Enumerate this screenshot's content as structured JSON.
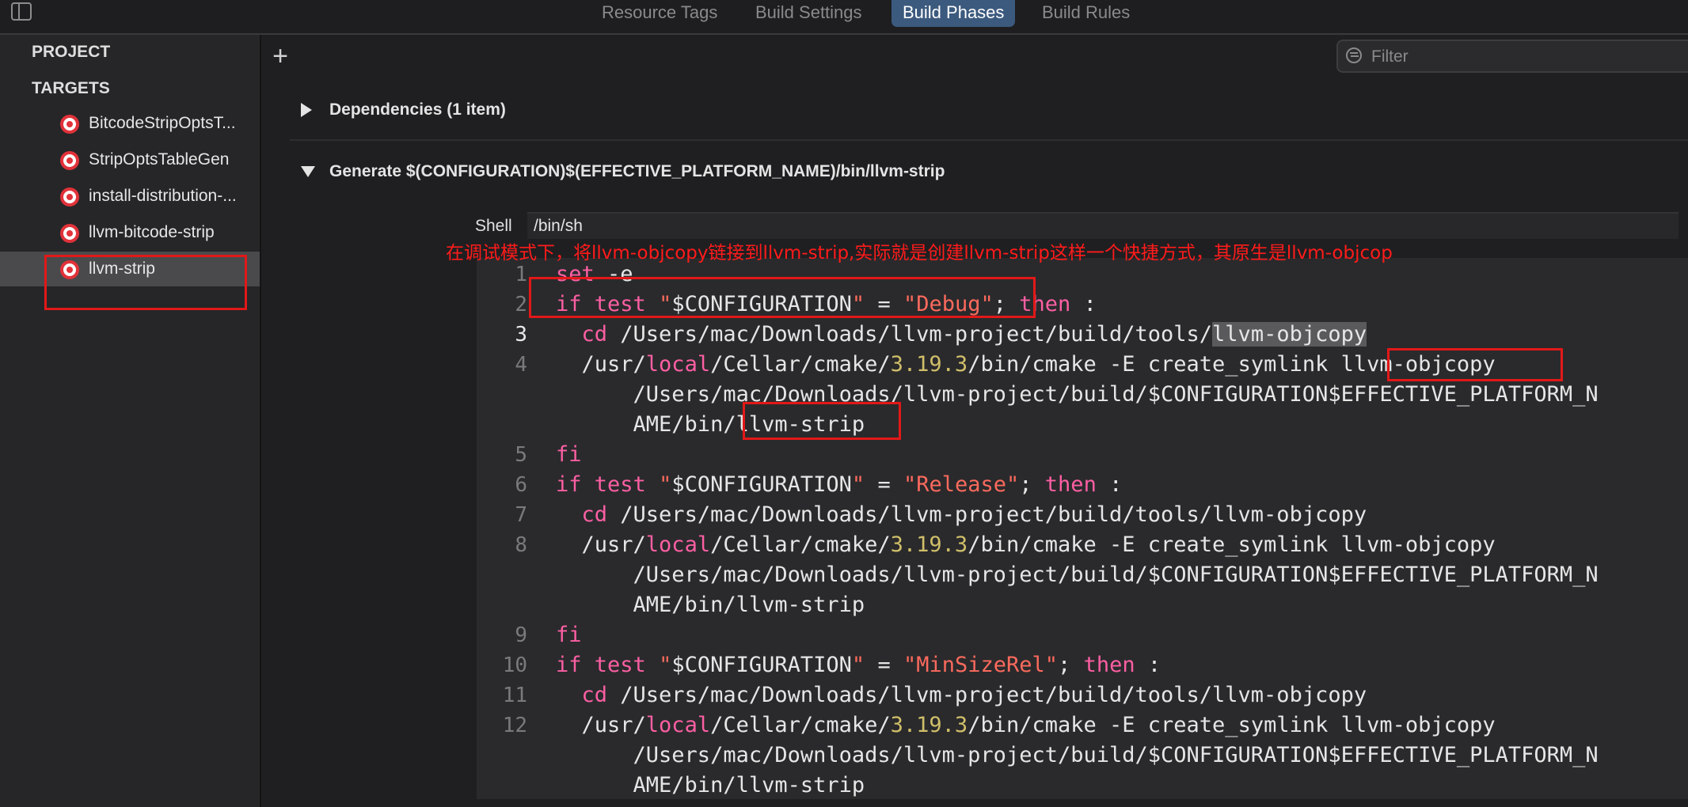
{
  "tabs": [
    {
      "label": "Resource Tags"
    },
    {
      "label": "Build Settings"
    },
    {
      "label": "Build Phases"
    },
    {
      "label": "Build Rules"
    }
  ],
  "sidebar": {
    "project_label": "PROJECT",
    "targets_label": "TARGETS",
    "targets": [
      {
        "label": "BitcodeStripOptsT..."
      },
      {
        "label": "StripOptsTableGen"
      },
      {
        "label": "install-distribution-..."
      },
      {
        "label": "llvm-bitcode-strip"
      },
      {
        "label": "llvm-strip"
      }
    ],
    "selected_index": 4
  },
  "toolbar": {
    "add_symbol": "+",
    "filter_placeholder": "Filter"
  },
  "phases": {
    "dependencies_title": "Dependencies (1 item)",
    "script_title": "Generate $(CONFIGURATION)$(EFFECTIVE_PLATFORM_NAME)/bin/llvm-strip",
    "shell_label": "Shell",
    "shell_value": "/bin/sh"
  },
  "annotation_text": "在调试模式下，将llvm-objcopy链接到llvm-strip,实际就是创建llvm-strip这样一个快捷方式，其原生是llvm-objcop",
  "code": {
    "current_line": 3,
    "lines": [
      {
        "n": "1",
        "tokens": [
          {
            "t": "set",
            "c": "kw"
          },
          {
            "t": " -e",
            "c": ""
          }
        ]
      },
      {
        "n": "2",
        "tokens": [
          {
            "t": "if",
            "c": "kw"
          },
          {
            "t": " ",
            "c": ""
          },
          {
            "t": "test",
            "c": "kw"
          },
          {
            "t": " ",
            "c": ""
          },
          {
            "t": "\"",
            "c": "str"
          },
          {
            "t": "$CONFIGURATION",
            "c": ""
          },
          {
            "t": "\"",
            "c": "str"
          },
          {
            "t": " = ",
            "c": ""
          },
          {
            "t": "\"Debug\"",
            "c": "str"
          },
          {
            "t": "; ",
            "c": ""
          },
          {
            "t": "then",
            "c": "kw"
          },
          {
            "t": " :",
            "c": ""
          }
        ]
      },
      {
        "n": "3",
        "tokens": [
          {
            "t": "  ",
            "c": ""
          },
          {
            "t": "cd",
            "c": "kw"
          },
          {
            "t": " /Users/mac/Downloads/llvm-project/build/tools/",
            "c": ""
          },
          {
            "t": "llvm-objcopy",
            "c": "hl"
          }
        ]
      },
      {
        "n": "4",
        "tokens": [
          {
            "t": "  /usr/",
            "c": ""
          },
          {
            "t": "local",
            "c": "kw"
          },
          {
            "t": "/Cellar/cmake/",
            "c": ""
          },
          {
            "t": "3.19.3",
            "c": "num"
          },
          {
            "t": "/bin/cmake -E create_symlink llvm-objcopy",
            "c": ""
          }
        ]
      },
      {
        "n": "",
        "tokens": [
          {
            "t": "      /Users/mac/Downloads/llvm-project/build/$CONFIGURATION$EFFECTIVE_PLATFORM_N",
            "c": ""
          }
        ]
      },
      {
        "n": "",
        "tokens": [
          {
            "t": "      AME/bin/llvm-strip",
            "c": ""
          }
        ]
      },
      {
        "n": "5",
        "tokens": [
          {
            "t": "fi",
            "c": "kw"
          }
        ]
      },
      {
        "n": "6",
        "tokens": [
          {
            "t": "if",
            "c": "kw"
          },
          {
            "t": " ",
            "c": ""
          },
          {
            "t": "test",
            "c": "kw"
          },
          {
            "t": " ",
            "c": ""
          },
          {
            "t": "\"",
            "c": "str"
          },
          {
            "t": "$CONFIGURATION",
            "c": ""
          },
          {
            "t": "\"",
            "c": "str"
          },
          {
            "t": " = ",
            "c": ""
          },
          {
            "t": "\"Release\"",
            "c": "str"
          },
          {
            "t": "; ",
            "c": ""
          },
          {
            "t": "then",
            "c": "kw"
          },
          {
            "t": " :",
            "c": ""
          }
        ]
      },
      {
        "n": "7",
        "tokens": [
          {
            "t": "  ",
            "c": ""
          },
          {
            "t": "cd",
            "c": "kw"
          },
          {
            "t": " /Users/mac/Downloads/llvm-project/build/tools/llvm-objcopy",
            "c": ""
          }
        ]
      },
      {
        "n": "8",
        "tokens": [
          {
            "t": "  /usr/",
            "c": ""
          },
          {
            "t": "local",
            "c": "kw"
          },
          {
            "t": "/Cellar/cmake/",
            "c": ""
          },
          {
            "t": "3.19.3",
            "c": "num"
          },
          {
            "t": "/bin/cmake -E create_symlink llvm-objcopy",
            "c": ""
          }
        ]
      },
      {
        "n": "",
        "tokens": [
          {
            "t": "      /Users/mac/Downloads/llvm-project/build/$CONFIGURATION$EFFECTIVE_PLATFORM_N",
            "c": ""
          }
        ]
      },
      {
        "n": "",
        "tokens": [
          {
            "t": "      AME/bin/llvm-strip",
            "c": ""
          }
        ]
      },
      {
        "n": "9",
        "tokens": [
          {
            "t": "fi",
            "c": "kw"
          }
        ]
      },
      {
        "n": "10",
        "tokens": [
          {
            "t": "if",
            "c": "kw"
          },
          {
            "t": " ",
            "c": ""
          },
          {
            "t": "test",
            "c": "kw"
          },
          {
            "t": " ",
            "c": ""
          },
          {
            "t": "\"",
            "c": "str"
          },
          {
            "t": "$CONFIGURATION",
            "c": ""
          },
          {
            "t": "\"",
            "c": "str"
          },
          {
            "t": " = ",
            "c": ""
          },
          {
            "t": "\"MinSizeRel\"",
            "c": "str"
          },
          {
            "t": "; ",
            "c": ""
          },
          {
            "t": "then",
            "c": "kw"
          },
          {
            "t": " :",
            "c": ""
          }
        ]
      },
      {
        "n": "11",
        "tokens": [
          {
            "t": "  ",
            "c": ""
          },
          {
            "t": "cd",
            "c": "kw"
          },
          {
            "t": " /Users/mac/Downloads/llvm-project/build/tools/llvm-objcopy",
            "c": ""
          }
        ]
      },
      {
        "n": "12",
        "tokens": [
          {
            "t": "  /usr/",
            "c": ""
          },
          {
            "t": "local",
            "c": "kw"
          },
          {
            "t": "/Cellar/cmake/",
            "c": ""
          },
          {
            "t": "3.19.3",
            "c": "num"
          },
          {
            "t": "/bin/cmake -E create_symlink llvm-objcopy",
            "c": ""
          }
        ]
      },
      {
        "n": "",
        "tokens": [
          {
            "t": "      /Users/mac/Downloads/llvm-project/build/$CONFIGURATION$EFFECTIVE_PLATFORM_N",
            "c": ""
          }
        ]
      },
      {
        "n": "",
        "tokens": [
          {
            "t": "      AME/bin/llvm-strip",
            "c": ""
          }
        ]
      }
    ]
  },
  "colors": {
    "annotation_red": "#e21818",
    "active_tab": "#3c5a7e",
    "keyword": "#fc5fa3",
    "string": "#fc6a5d",
    "number": "#d0bf69"
  }
}
